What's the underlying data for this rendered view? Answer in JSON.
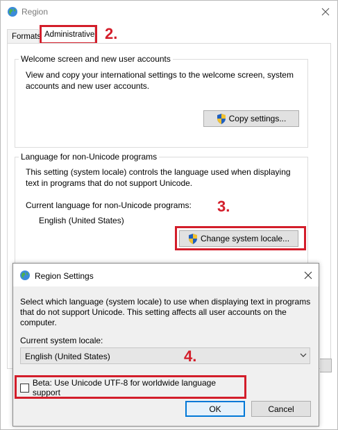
{
  "region_window": {
    "title": "Region",
    "tabs": [
      "Formats",
      "Administrative"
    ],
    "welcome_group": {
      "legend": "Welcome screen and new user accounts",
      "description": "View and copy your international settings to the welcome screen, system accounts and new user accounts.",
      "copy_button": "Copy settings..."
    },
    "non_unicode_group": {
      "legend": "Language for non-Unicode programs",
      "description": "This setting (system locale) controls the language used when displaying text in programs that do not support Unicode.",
      "current_label": "Current language for non-Unicode programs:",
      "current_value": "English (United States)",
      "change_button": "Change system locale..."
    }
  },
  "dialog": {
    "title": "Region Settings",
    "description": "Select which language (system locale) to use when displaying text in programs that do not support Unicode. This setting affects all user accounts on the computer.",
    "current_locale_label": "Current system locale:",
    "current_locale_value": "English (United States)",
    "beta_checkbox_label": "Beta: Use Unicode UTF-8 for worldwide language support",
    "beta_checked": false,
    "ok_label": "OK",
    "cancel_label": "Cancel"
  },
  "annotations": {
    "step2": "2.",
    "step3": "3.",
    "step4": "4.",
    "color": "#d31d2a"
  },
  "icons": {
    "app": "globe-icon",
    "uac": "shield-icon",
    "close": "close-icon",
    "dropdown": "chevron-down-icon"
  }
}
